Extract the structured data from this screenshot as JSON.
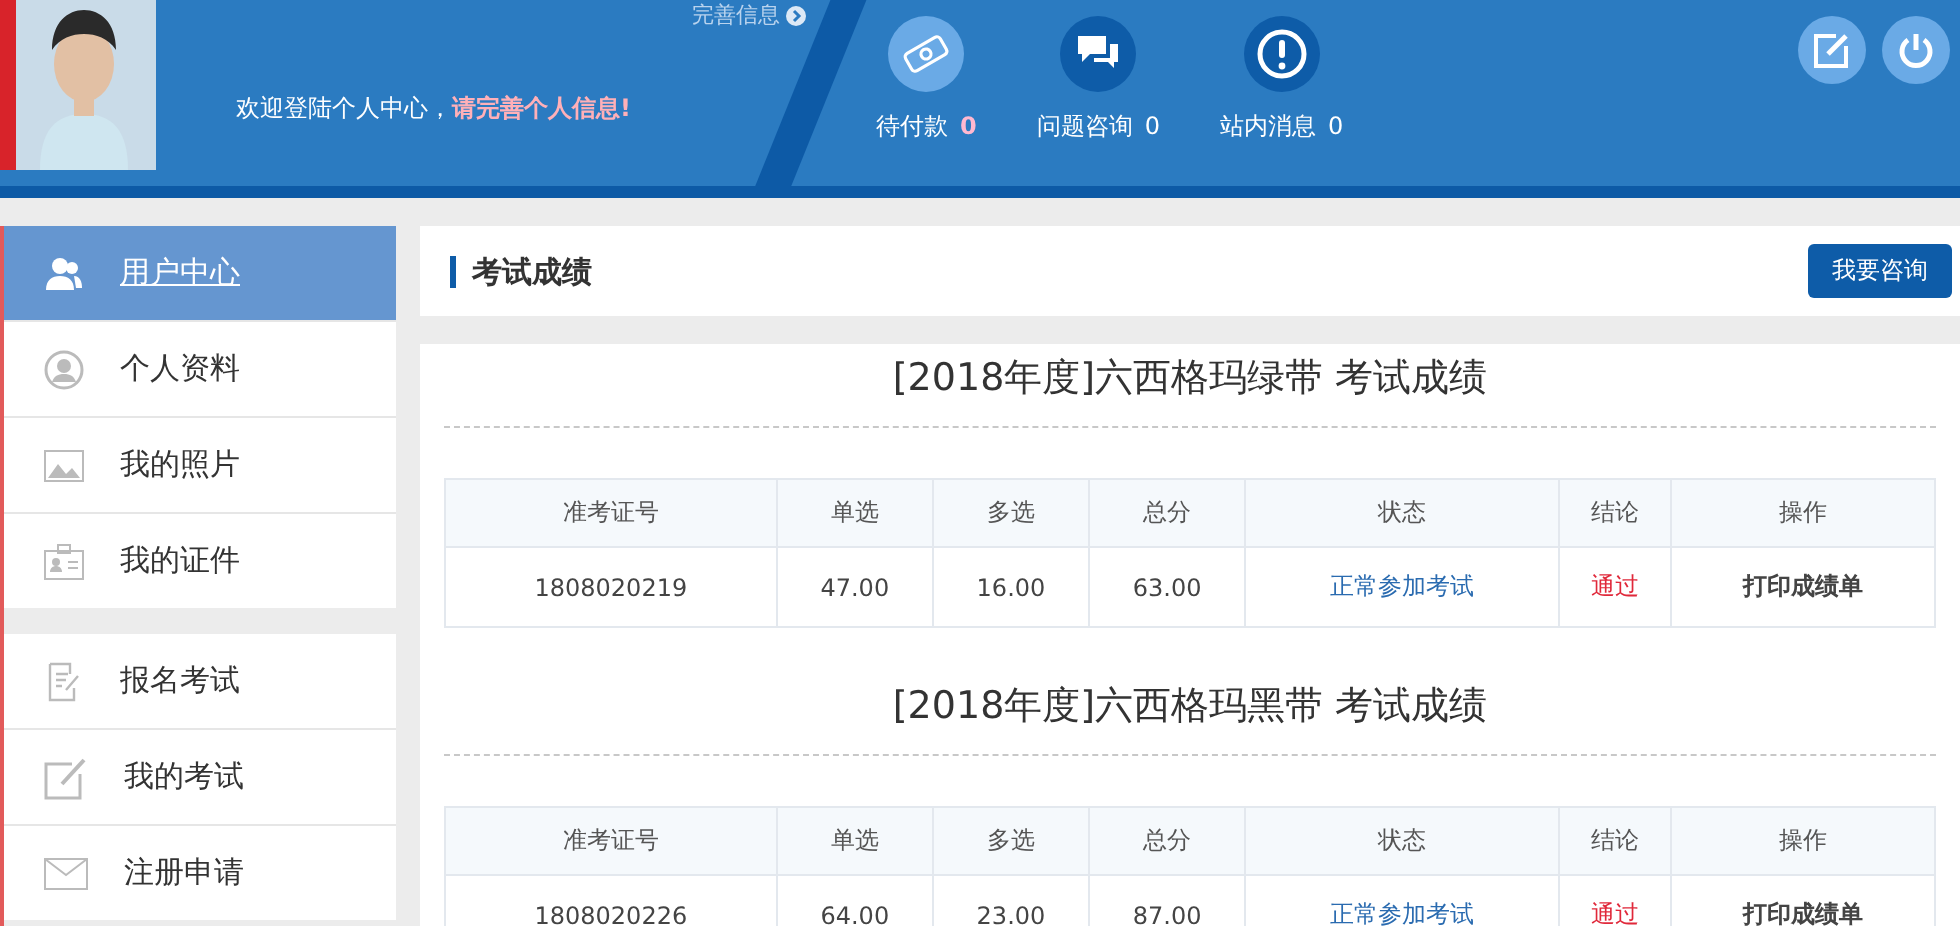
{
  "header": {
    "complete_link": "完善信息",
    "welcome": "欢迎登陆个人中心，",
    "welcome_alert": "请完善个人信息!",
    "stats": [
      {
        "kind": "money",
        "label": "待付款",
        "count": "0",
        "alert": true
      },
      {
        "kind": "chat",
        "label": "问题咨询",
        "count": "0",
        "alert": false
      },
      {
        "kind": "notice",
        "label": "站内消息",
        "count": "0",
        "alert": false
      }
    ]
  },
  "sidebar": {
    "groups": [
      [
        {
          "kind": "users",
          "label": "用户中心",
          "selected": true
        },
        {
          "kind": "person",
          "label": "个人资料",
          "selected": false
        },
        {
          "label": "我的照片",
          "selected": false
        },
        {
          "kind": "card",
          "label": "我的证件",
          "selected": false
        }
      ],
      [
        {
          "kind": "form",
          "label": "报名考试",
          "selected": false
        },
        {
          "kind": "edit",
          "label": "我的考试",
          "selected": false
        },
        {
          "kind": "mail",
          "label": "注册申请",
          "selected": false
        }
      ]
    ]
  },
  "main": {
    "title": "考试成绩",
    "consult_button": "我要咨询",
    "sections": [
      {
        "title": "[2018年度]六西格玛绿带 考试成绩",
        "columns": [
          "准考证号",
          "单选",
          "多选",
          "总分",
          "状态",
          "结论",
          "操作"
        ],
        "rows": [
          [
            "1808020219",
            "47.00",
            "16.00",
            "63.00",
            "正常参加考试",
            "通过",
            "打印成绩单"
          ]
        ]
      },
      {
        "title": "[2018年度]六西格玛黑带 考试成绩",
        "columns": [
          "准考证号",
          "单选",
          "多选",
          "总分",
          "状态",
          "结论",
          "操作"
        ],
        "rows": [
          [
            "1808020226",
            "64.00",
            "23.00",
            "87.00",
            "正常参加考试",
            "通过",
            "打印成绩单"
          ]
        ]
      }
    ]
  }
}
